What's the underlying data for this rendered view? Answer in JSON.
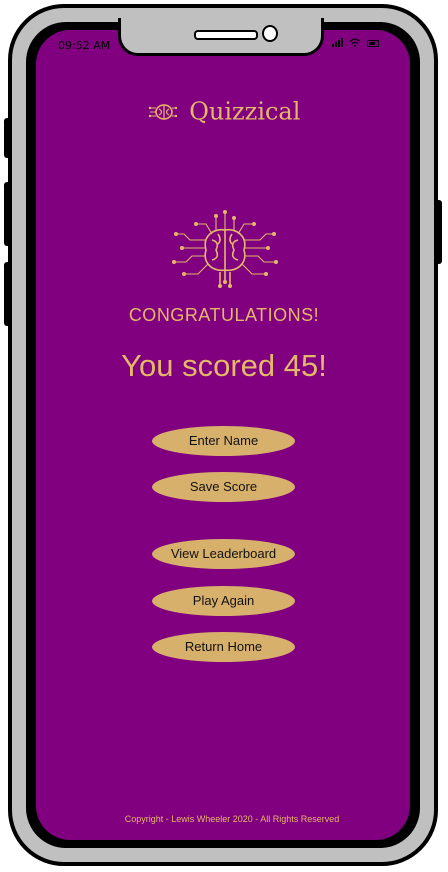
{
  "status_bar": {
    "time": "09:52 AM"
  },
  "brand": {
    "title": "Quizzical"
  },
  "result": {
    "heading": "CONGRATULATIONS!",
    "score_text": "You scored 45!"
  },
  "actions": {
    "enter_name": "Enter Name",
    "save_score": "Save Score",
    "view_leaderboard": "View Leaderboard",
    "play_again": "Play Again",
    "return_home": "Return Home"
  },
  "footer": {
    "copyright": "Copyright - Lewis Wheeler 2020 - All Rights Reserved"
  },
  "colors": {
    "screen_background": "#800080",
    "accent_text": "#e5b769",
    "button_fill": "#d7b06c",
    "device_frame": "#c0c0c0"
  },
  "icons": [
    "circuit-brain-icon",
    "signal-icon",
    "wifi-icon",
    "battery-icon"
  ]
}
